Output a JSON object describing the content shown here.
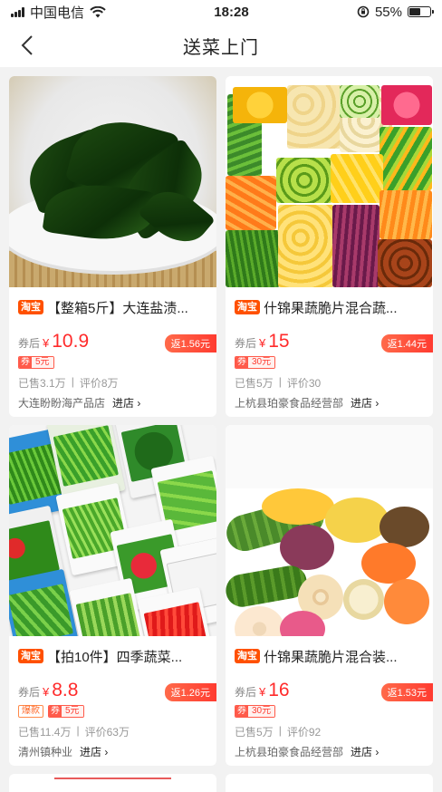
{
  "status": {
    "carrier": "中国电信",
    "time": "18:28",
    "battery": "55%",
    "battery_level": 0.55
  },
  "nav": {
    "title": "送菜上门"
  },
  "products": [
    {
      "platform": "淘宝",
      "title": "【整箱5斤】大连盐渍...",
      "after_coupon_label": "券后",
      "currency": "¥",
      "price": "10.9",
      "rebate": "返1.56元",
      "coupon_prefix": "券",
      "coupon_amount": "5元",
      "sold": "已售3.1万",
      "reviews": "评价8万",
      "shop": "大连盼盼海产品店",
      "enter": "进店 ›"
    },
    {
      "platform": "淘宝",
      "title": "什锦果蔬脆片混合蔬...",
      "after_coupon_label": "券后",
      "currency": "¥",
      "price": "15",
      "rebate": "返1.44元",
      "coupon_prefix": "券",
      "coupon_amount": "30元",
      "sold": "已售5万",
      "reviews": "评价30",
      "shop": "上杭县珀豪食品经营部",
      "enter": "进店 ›"
    },
    {
      "platform": "淘宝",
      "title": "【拍10件】四季蔬菜...",
      "after_coupon_label": "券后",
      "currency": "¥",
      "price": "8.8",
      "rebate": "返1.26元",
      "hot_tag": "爆款",
      "coupon_prefix": "券",
      "coupon_amount": "5元",
      "sold": "已售11.4万",
      "reviews": "评价63万",
      "shop": "清州镇种业",
      "enter": "进店 ›"
    },
    {
      "platform": "淘宝",
      "title": "什锦果蔬脆片混合装...",
      "after_coupon_label": "券后",
      "currency": "¥",
      "price": "16",
      "rebate": "返1.53元",
      "coupon_prefix": "券",
      "coupon_amount": "30元",
      "sold": "已售5万",
      "reviews": "评价92",
      "shop": "上杭县珀豪食品经营部",
      "enter": "进店 ›"
    }
  ],
  "icons": {
    "back": "chevron-left-icon",
    "wifi": "wifi-icon",
    "signal": "signal-icon",
    "battery": "battery-icon",
    "rotation_lock": "rotation-lock-icon"
  },
  "colors": {
    "price": "#ff2b2b",
    "taobao": "#ff5000",
    "rebate": "#ff3b30"
  }
}
